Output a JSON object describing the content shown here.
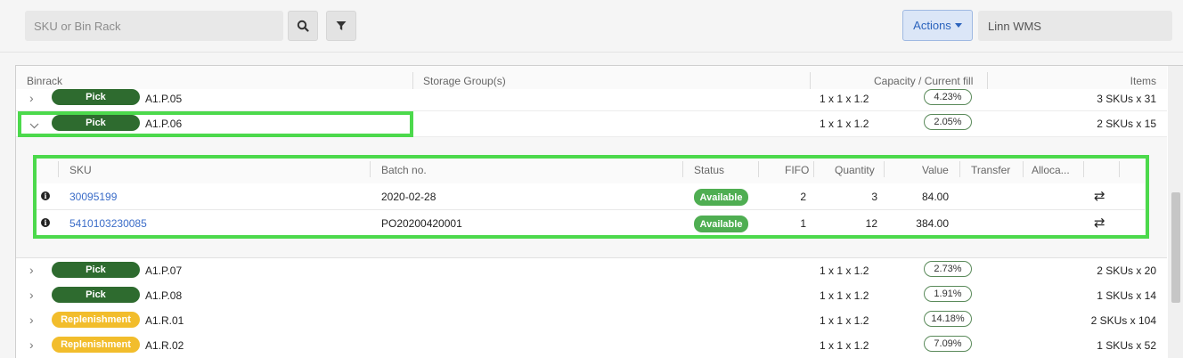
{
  "toolbar": {
    "search_placeholder": "SKU or Bin Rack",
    "search_icon": "search-icon",
    "filter_icon": "filter-icon",
    "actions_label": "Actions",
    "location_value": "Linn WMS"
  },
  "grid": {
    "headers": {
      "binrack": "Binrack",
      "storage_groups": "Storage Group(s)",
      "capacity": "Capacity / Current fill",
      "items": "Items"
    },
    "rows": [
      {
        "type": "Pick",
        "bin": "A1.P.05",
        "capacity": "1 x 1 x 1.2",
        "fill": "4.23%",
        "items": "3 SKUs x 31",
        "expanded": false
      },
      {
        "type": "Pick",
        "bin": "A1.P.06",
        "capacity": "1 x 1 x 1.2",
        "fill": "2.05%",
        "items": "2 SKUs x 15",
        "expanded": true
      },
      {
        "type": "Pick",
        "bin": "A1.P.07",
        "capacity": "1 x 1 x 1.2",
        "fill": "2.73%",
        "items": "2 SKUs x 20",
        "expanded": false
      },
      {
        "type": "Pick",
        "bin": "A1.P.08",
        "capacity": "1 x 1 x 1.2",
        "fill": "1.91%",
        "items": "1 SKUs x 14",
        "expanded": false
      },
      {
        "type": "Replenishment",
        "bin": "A1.R.01",
        "capacity": "1 x 1 x 1.2",
        "fill": "14.18%",
        "items": "2 SKUs x 104",
        "expanded": false
      },
      {
        "type": "Replenishment",
        "bin": "A1.R.02",
        "capacity": "1 x 1 x 1.2",
        "fill": "7.09%",
        "items": "1 SKUs x 52",
        "expanded": false
      }
    ]
  },
  "subgrid": {
    "headers": {
      "sku": "SKU",
      "batch": "Batch no.",
      "status": "Status",
      "fifo": "FIFO",
      "quantity": "Quantity",
      "value": "Value",
      "transfer": "Transfer",
      "allocated": "Alloca..."
    },
    "rows": [
      {
        "sku": "30095199",
        "batch": "2020-02-28",
        "status": "Available",
        "fifo": "2",
        "quantity": "3",
        "value": "84.00"
      },
      {
        "sku": "5410103230085",
        "batch": "PO20200420001",
        "status": "Available",
        "fifo": "1",
        "quantity": "12",
        "value": "384.00"
      }
    ]
  },
  "colors": {
    "pick_badge": "#2e6b2f",
    "replenishment_badge": "#f2bd2c",
    "available_badge": "#4fae52",
    "highlight": "#4cd94c",
    "link": "#3a6cc8"
  }
}
